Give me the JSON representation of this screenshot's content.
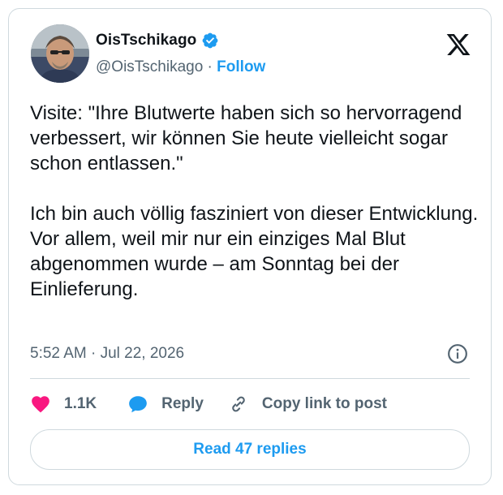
{
  "author": {
    "display_name": "OisTschikago",
    "handle": "@OisTschikago",
    "separator": " · ",
    "follow_label": "Follow"
  },
  "tweet": {
    "text": "Visite: \"Ihre Blutwerte haben sich so hervorragend verbessert, wir können Sie heute vielleicht sogar schon entlassen.\"\n\nIch bin auch völlig fasziniert von dieser Entwicklung. Vor allem, weil mir nur ein einziges Mal Blut abgenommen wurde – am Sonntag bei der Einlieferung.",
    "timestamp": "5:52 AM · Jul 22, 2026"
  },
  "actions": {
    "like_count": "1.1K",
    "reply_label": "Reply",
    "copy_link_label": "Copy link to post"
  },
  "footer": {
    "read_replies_label": "Read 47 replies"
  },
  "colors": {
    "accent": "#1d9bf0",
    "like": "#f91880",
    "secondary_text": "#536471",
    "border": "#cfd9de"
  },
  "icons": [
    "verified-badge-icon",
    "x-logo-icon",
    "info-icon",
    "heart-icon",
    "reply-bubble-icon",
    "link-icon"
  ]
}
